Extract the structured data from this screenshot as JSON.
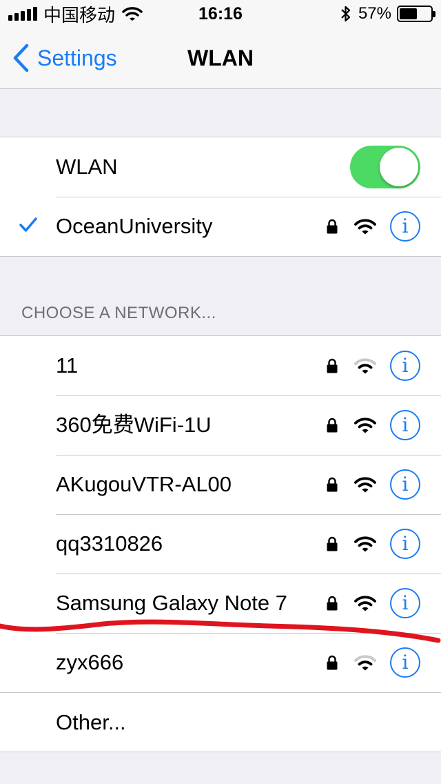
{
  "status_bar": {
    "carrier": "中国移动",
    "time": "16:16",
    "battery_percent": "57%",
    "battery_level": 0.57,
    "icons": [
      "signal-icon",
      "wifi-icon",
      "bluetooth-icon",
      "battery-icon"
    ]
  },
  "nav": {
    "back_label": "Settings",
    "title": "WLAN"
  },
  "wlan_toggle": {
    "label": "WLAN",
    "on": true,
    "color": "#4cd964"
  },
  "connected_network": {
    "name": "OceanUniversity",
    "secured": true,
    "signal": "strong"
  },
  "section_header": "CHOOSE A NETWORK...",
  "networks": [
    {
      "name": "11",
      "secured": true,
      "signal": "weak"
    },
    {
      "name": "360免费WiFi-1U",
      "secured": true,
      "signal": "strong"
    },
    {
      "name": "AKugouVTR-AL00",
      "secured": true,
      "signal": "strong"
    },
    {
      "name": "qq3310826",
      "secured": true,
      "signal": "strong"
    },
    {
      "name": "Samsung Galaxy Note 7",
      "secured": true,
      "signal": "strong"
    },
    {
      "name": "zyx666",
      "secured": true,
      "signal": "weak"
    }
  ],
  "other_label": "Other...",
  "info_glyph": "i",
  "colors": {
    "accent": "#1a7cf5",
    "annotation": "#e0141e"
  }
}
